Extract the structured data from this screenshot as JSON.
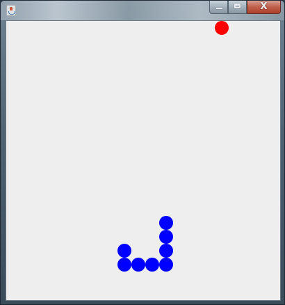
{
  "window": {
    "app_icon": "java-icon",
    "controls": {
      "minimize_icon": "minimize-icon",
      "maximize_icon": "maximize-icon",
      "close_glyph": "X"
    }
  },
  "game": {
    "background_color": "#eeeeee",
    "food": {
      "color": "#ff0000",
      "cell": [
        15,
        0
      ]
    },
    "snake": {
      "color": "#0000ff",
      "segments": [
        [
          11,
          14
        ],
        [
          11,
          15
        ],
        [
          11,
          16
        ],
        [
          11,
          17
        ],
        [
          10,
          17
        ],
        [
          9,
          17
        ],
        [
          8,
          17
        ],
        [
          8,
          16
        ]
      ]
    }
  }
}
